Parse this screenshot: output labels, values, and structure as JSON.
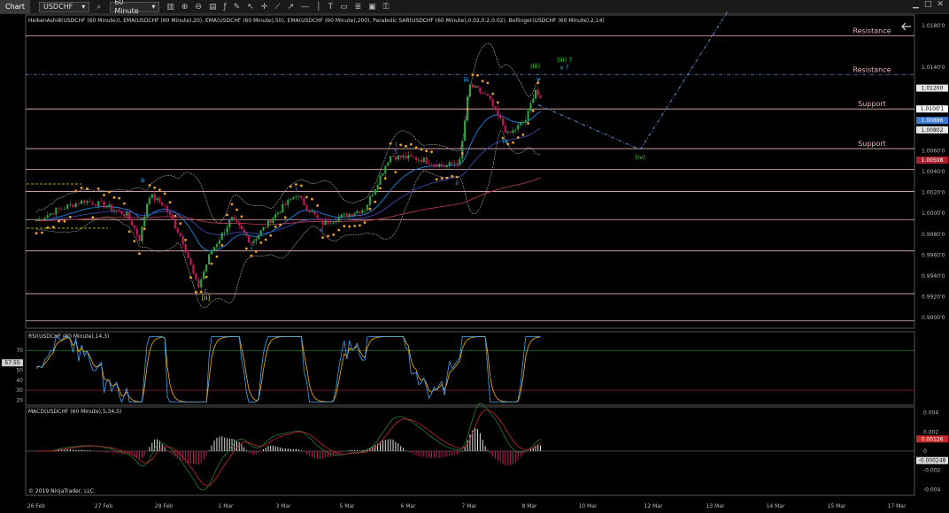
{
  "toolbar": {
    "chart_label": "Chart",
    "symbol": "USDCHF",
    "interval": "60 Minute"
  },
  "panels": {
    "price_title": "HeikenAshi8(USDCHF (60 Minute)), EMA(USDCHF (60 Minute),20), EMA(USDCHF (60 Minute),50), EMA(USDCHF (60 Minute),200), Parabolic SAR(USDCHF (60 Minute),0.02,0.2,0.02), Bollinger(USDCHF (60 Minute),2,14)",
    "rsi_title": "RSI(USDCHF (60 Minute),14,3)",
    "macd_title": "MACD(USDCHF (60 Minute),5,34,5)",
    "copyright": "© 2019 NinjaTrader, LLC"
  },
  "chart_data": {
    "type": "line",
    "x_ticks": [
      "26 Feb",
      "27 Feb",
      "28 Feb",
      "1 Mar",
      "3 Mar",
      "5 Mar",
      "6 Mar",
      "7 Mar",
      "8 Mar",
      "10 Mar",
      "12 Mar",
      "13 Mar",
      "14 Mar",
      "15 Mar",
      "17 Mar"
    ],
    "price_axis": [
      "1.0180'0",
      "1.0140'0",
      "1.0100'0",
      "1.0060'0",
      "1.0040'0",
      "1.0020'0",
      "1.0000'0",
      "0.9980'0",
      "0.9960'0",
      "0.9940'0",
      "0.9920'0",
      "0.9900'0"
    ],
    "price_ylim": [
      0.989,
      1.019
    ],
    "price_markers": [
      {
        "label": "1.01200",
        "value": 1.012,
        "color": "#e8e8e8"
      },
      {
        "label": "1.0100'1",
        "value": 1.01,
        "color": "#ffffff"
      },
      {
        "label": "1.00886",
        "value": 1.0089,
        "color": "#3a7bd5"
      },
      {
        "label": "1.00802",
        "value": 1.008,
        "color": "#e8e8e8"
      },
      {
        "label": "1.00508",
        "value": 1.0051,
        "color": "#b0202c"
      }
    ],
    "levels": [
      {
        "label": "Resistance",
        "value": 1.017
      },
      {
        "label": "Resistance",
        "value": 1.0133
      },
      {
        "label": "Support",
        "value": 1.01
      },
      {
        "label": "Support",
        "value": 1.0062
      },
      {
        "label": "",
        "value": 1.0042
      },
      {
        "label": "",
        "value": 1.0021
      },
      {
        "label": "",
        "value": 0.9994
      },
      {
        "label": "",
        "value": 0.9964
      },
      {
        "label": "",
        "value": 0.9923
      },
      {
        "label": "",
        "value": 0.9897
      }
    ],
    "wave_labels": [
      {
        "text": "b",
        "color": "#29b6f6",
        "x": 27.65,
        "y": 1.003
      },
      {
        "text": "c",
        "color": "#29b6f6",
        "x": 28.68,
        "y": 0.9924
      },
      {
        "text": "[ii]",
        "color": "#e6e600",
        "x": 28.68,
        "y": 0.9917
      },
      {
        "text": "1",
        "color": "#5c6bc0",
        "x": 29.05,
        "y": 0.999
      },
      {
        "text": "2",
        "color": "#5c6bc0",
        "x": 29.45,
        "y": 0.9966
      },
      {
        "text": "3",
        "color": "#5c6bc0",
        "x": 30.2,
        "y": 1.0021
      },
      {
        "text": "4",
        "color": "#5c6bc0",
        "x": 30.6,
        "y": 0.9982
      },
      {
        "text": "5",
        "color": "#5c6bc0",
        "x": 31.8,
        "y": 1.0057
      },
      {
        "text": "i",
        "color": "#29b6f6",
        "x": 31.8,
        "y": 1.0064
      },
      {
        "text": "ii",
        "color": "#29b6f6",
        "x": 32.8,
        "y": 1.0027
      },
      {
        "text": "iii",
        "color": "#29b6f6",
        "x": 32.95,
        "y": 1.0126
      },
      {
        "text": "iv",
        "color": "#29b6f6",
        "x": 33.6,
        "y": 1.0067
      },
      {
        "text": "v",
        "color": "#29b6f6",
        "x": 34.15,
        "y": 1.0127
      },
      {
        "text": "(iii)",
        "color": "#35d435",
        "x": 34.1,
        "y": 1.0139
      },
      {
        "text": "(iii) ?",
        "color": "#35d435",
        "x": 34.6,
        "y": 1.0145
      },
      {
        "text": "v ?",
        "color": "#29b6f6",
        "x": 34.6,
        "y": 1.0138
      },
      {
        "text": "(iv)",
        "color": "#35d435",
        "x": 35.8,
        "y": 1.0052
      }
    ],
    "projection": [
      {
        "x": 34.15,
        "y": 1.0104
      },
      {
        "x": 35.8,
        "y": 1.0061
      },
      {
        "x": 37.2,
        "y": 1.0193
      }
    ],
    "rsi_axis": [
      "70",
      "57.55",
      "50",
      "40",
      "30",
      "20"
    ],
    "rsi_ylim": [
      15,
      88
    ],
    "rsi_current": "57.55",
    "macd_axis": [
      "0.004",
      "0.002",
      "0",
      "-0.002",
      "-0.004"
    ],
    "macd_ylim": [
      -0.0046,
      0.0046
    ],
    "macd_markers": [
      "0.00126",
      "-0.000248"
    ]
  }
}
